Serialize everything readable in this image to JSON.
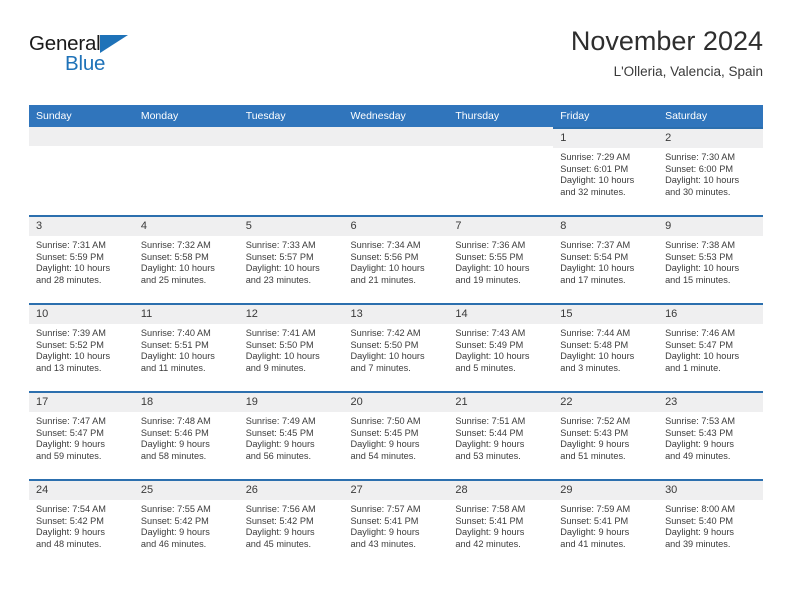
{
  "brand": {
    "name_part1": "General",
    "name_part2": "Blue",
    "accent_color": "#1e72b8",
    "triangle_icon": "triangle-icon"
  },
  "header": {
    "title": "November 2024",
    "subtitle": "L'Olleria, Valencia, Spain"
  },
  "calendar": {
    "header_bg": "#3075bc",
    "daynum_bg": "#efeff0",
    "row_rule_color": "#2c6fae",
    "weekdays": [
      "Sunday",
      "Monday",
      "Tuesday",
      "Wednesday",
      "Thursday",
      "Friday",
      "Saturday"
    ],
    "weeks": [
      [
        {
          "day": "",
          "sunrise": "",
          "sunset": "",
          "daylight1": "",
          "daylight2": "",
          "blank": true
        },
        {
          "day": "",
          "sunrise": "",
          "sunset": "",
          "daylight1": "",
          "daylight2": "",
          "blank": true
        },
        {
          "day": "",
          "sunrise": "",
          "sunset": "",
          "daylight1": "",
          "daylight2": "",
          "blank": true
        },
        {
          "day": "",
          "sunrise": "",
          "sunset": "",
          "daylight1": "",
          "daylight2": "",
          "blank": true
        },
        {
          "day": "",
          "sunrise": "",
          "sunset": "",
          "daylight1": "",
          "daylight2": "",
          "blank": true
        },
        {
          "day": "1",
          "sunrise": "Sunrise: 7:29 AM",
          "sunset": "Sunset: 6:01 PM",
          "daylight1": "Daylight: 10 hours",
          "daylight2": "and 32 minutes.",
          "blank": false
        },
        {
          "day": "2",
          "sunrise": "Sunrise: 7:30 AM",
          "sunset": "Sunset: 6:00 PM",
          "daylight1": "Daylight: 10 hours",
          "daylight2": "and 30 minutes.",
          "blank": false
        }
      ],
      [
        {
          "day": "3",
          "sunrise": "Sunrise: 7:31 AM",
          "sunset": "Sunset: 5:59 PM",
          "daylight1": "Daylight: 10 hours",
          "daylight2": "and 28 minutes.",
          "blank": false
        },
        {
          "day": "4",
          "sunrise": "Sunrise: 7:32 AM",
          "sunset": "Sunset: 5:58 PM",
          "daylight1": "Daylight: 10 hours",
          "daylight2": "and 25 minutes.",
          "blank": false
        },
        {
          "day": "5",
          "sunrise": "Sunrise: 7:33 AM",
          "sunset": "Sunset: 5:57 PM",
          "daylight1": "Daylight: 10 hours",
          "daylight2": "and 23 minutes.",
          "blank": false
        },
        {
          "day": "6",
          "sunrise": "Sunrise: 7:34 AM",
          "sunset": "Sunset: 5:56 PM",
          "daylight1": "Daylight: 10 hours",
          "daylight2": "and 21 minutes.",
          "blank": false
        },
        {
          "day": "7",
          "sunrise": "Sunrise: 7:36 AM",
          "sunset": "Sunset: 5:55 PM",
          "daylight1": "Daylight: 10 hours",
          "daylight2": "and 19 minutes.",
          "blank": false
        },
        {
          "day": "8",
          "sunrise": "Sunrise: 7:37 AM",
          "sunset": "Sunset: 5:54 PM",
          "daylight1": "Daylight: 10 hours",
          "daylight2": "and 17 minutes.",
          "blank": false
        },
        {
          "day": "9",
          "sunrise": "Sunrise: 7:38 AM",
          "sunset": "Sunset: 5:53 PM",
          "daylight1": "Daylight: 10 hours",
          "daylight2": "and 15 minutes.",
          "blank": false
        }
      ],
      [
        {
          "day": "10",
          "sunrise": "Sunrise: 7:39 AM",
          "sunset": "Sunset: 5:52 PM",
          "daylight1": "Daylight: 10 hours",
          "daylight2": "and 13 minutes.",
          "blank": false
        },
        {
          "day": "11",
          "sunrise": "Sunrise: 7:40 AM",
          "sunset": "Sunset: 5:51 PM",
          "daylight1": "Daylight: 10 hours",
          "daylight2": "and 11 minutes.",
          "blank": false
        },
        {
          "day": "12",
          "sunrise": "Sunrise: 7:41 AM",
          "sunset": "Sunset: 5:50 PM",
          "daylight1": "Daylight: 10 hours",
          "daylight2": "and 9 minutes.",
          "blank": false
        },
        {
          "day": "13",
          "sunrise": "Sunrise: 7:42 AM",
          "sunset": "Sunset: 5:50 PM",
          "daylight1": "Daylight: 10 hours",
          "daylight2": "and 7 minutes.",
          "blank": false
        },
        {
          "day": "14",
          "sunrise": "Sunrise: 7:43 AM",
          "sunset": "Sunset: 5:49 PM",
          "daylight1": "Daylight: 10 hours",
          "daylight2": "and 5 minutes.",
          "blank": false
        },
        {
          "day": "15",
          "sunrise": "Sunrise: 7:44 AM",
          "sunset": "Sunset: 5:48 PM",
          "daylight1": "Daylight: 10 hours",
          "daylight2": "and 3 minutes.",
          "blank": false
        },
        {
          "day": "16",
          "sunrise": "Sunrise: 7:46 AM",
          "sunset": "Sunset: 5:47 PM",
          "daylight1": "Daylight: 10 hours",
          "daylight2": "and 1 minute.",
          "blank": false
        }
      ],
      [
        {
          "day": "17",
          "sunrise": "Sunrise: 7:47 AM",
          "sunset": "Sunset: 5:47 PM",
          "daylight1": "Daylight: 9 hours",
          "daylight2": "and 59 minutes.",
          "blank": false
        },
        {
          "day": "18",
          "sunrise": "Sunrise: 7:48 AM",
          "sunset": "Sunset: 5:46 PM",
          "daylight1": "Daylight: 9 hours",
          "daylight2": "and 58 minutes.",
          "blank": false
        },
        {
          "day": "19",
          "sunrise": "Sunrise: 7:49 AM",
          "sunset": "Sunset: 5:45 PM",
          "daylight1": "Daylight: 9 hours",
          "daylight2": "and 56 minutes.",
          "blank": false
        },
        {
          "day": "20",
          "sunrise": "Sunrise: 7:50 AM",
          "sunset": "Sunset: 5:45 PM",
          "daylight1": "Daylight: 9 hours",
          "daylight2": "and 54 minutes.",
          "blank": false
        },
        {
          "day": "21",
          "sunrise": "Sunrise: 7:51 AM",
          "sunset": "Sunset: 5:44 PM",
          "daylight1": "Daylight: 9 hours",
          "daylight2": "and 53 minutes.",
          "blank": false
        },
        {
          "day": "22",
          "sunrise": "Sunrise: 7:52 AM",
          "sunset": "Sunset: 5:43 PM",
          "daylight1": "Daylight: 9 hours",
          "daylight2": "and 51 minutes.",
          "blank": false
        },
        {
          "day": "23",
          "sunrise": "Sunrise: 7:53 AM",
          "sunset": "Sunset: 5:43 PM",
          "daylight1": "Daylight: 9 hours",
          "daylight2": "and 49 minutes.",
          "blank": false
        }
      ],
      [
        {
          "day": "24",
          "sunrise": "Sunrise: 7:54 AM",
          "sunset": "Sunset: 5:42 PM",
          "daylight1": "Daylight: 9 hours",
          "daylight2": "and 48 minutes.",
          "blank": false
        },
        {
          "day": "25",
          "sunrise": "Sunrise: 7:55 AM",
          "sunset": "Sunset: 5:42 PM",
          "daylight1": "Daylight: 9 hours",
          "daylight2": "and 46 minutes.",
          "blank": false
        },
        {
          "day": "26",
          "sunrise": "Sunrise: 7:56 AM",
          "sunset": "Sunset: 5:42 PM",
          "daylight1": "Daylight: 9 hours",
          "daylight2": "and 45 minutes.",
          "blank": false
        },
        {
          "day": "27",
          "sunrise": "Sunrise: 7:57 AM",
          "sunset": "Sunset: 5:41 PM",
          "daylight1": "Daylight: 9 hours",
          "daylight2": "and 43 minutes.",
          "blank": false
        },
        {
          "day": "28",
          "sunrise": "Sunrise: 7:58 AM",
          "sunset": "Sunset: 5:41 PM",
          "daylight1": "Daylight: 9 hours",
          "daylight2": "and 42 minutes.",
          "blank": false
        },
        {
          "day": "29",
          "sunrise": "Sunrise: 7:59 AM",
          "sunset": "Sunset: 5:41 PM",
          "daylight1": "Daylight: 9 hours",
          "daylight2": "and 41 minutes.",
          "blank": false
        },
        {
          "day": "30",
          "sunrise": "Sunrise: 8:00 AM",
          "sunset": "Sunset: 5:40 PM",
          "daylight1": "Daylight: 9 hours",
          "daylight2": "and 39 minutes.",
          "blank": false
        }
      ]
    ]
  }
}
